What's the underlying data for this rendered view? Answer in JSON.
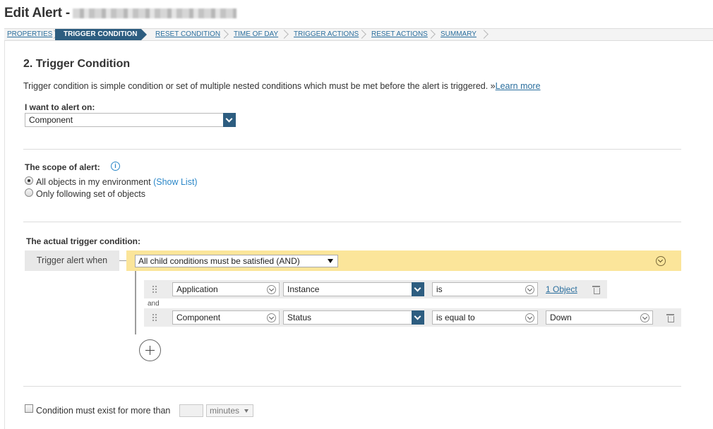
{
  "page": {
    "title": "Edit Alert -"
  },
  "wizard": {
    "steps": [
      {
        "label": "PROPERTIES"
      },
      {
        "label": "TRIGGER CONDITION",
        "active": true
      },
      {
        "label": "RESET CONDITION"
      },
      {
        "label": "TIME OF DAY"
      },
      {
        "label": "TRIGGER ACTIONS"
      },
      {
        "label": "RESET ACTIONS"
      },
      {
        "label": "SUMMARY"
      }
    ]
  },
  "section": {
    "title": "2. Trigger Condition",
    "description": "Trigger condition is simple condition or set of multiple nested conditions which must be met before the alert is triggered. »",
    "learn_more": "Learn more"
  },
  "alert_on": {
    "label": "I want to alert on:",
    "value": "Component"
  },
  "scope": {
    "label": "The scope of alert:",
    "info_icon": "info-icon",
    "options": [
      {
        "label": "All objects in my environment",
        "link": "(Show List)",
        "checked": true
      },
      {
        "label": "Only following set of objects",
        "checked": false
      }
    ]
  },
  "trigger": {
    "label": "The actual trigger condition:",
    "when_label": "Trigger alert when",
    "group_operator": "All child conditions must be satisfied (AND)",
    "and_label": "and",
    "conditions": [
      {
        "entity": "Application",
        "field": "Instance",
        "operator": "is",
        "value": "1 Object"
      },
      {
        "entity": "Component",
        "field": "Status",
        "operator": "is equal to",
        "value": "Down"
      }
    ]
  },
  "duration": {
    "label": "Condition must exist for more than",
    "value": "",
    "unit": "minutes"
  },
  "colors": {
    "accent": "#2d5d80",
    "link": "#2b6f9e",
    "group_bar": "#fbe59a"
  }
}
